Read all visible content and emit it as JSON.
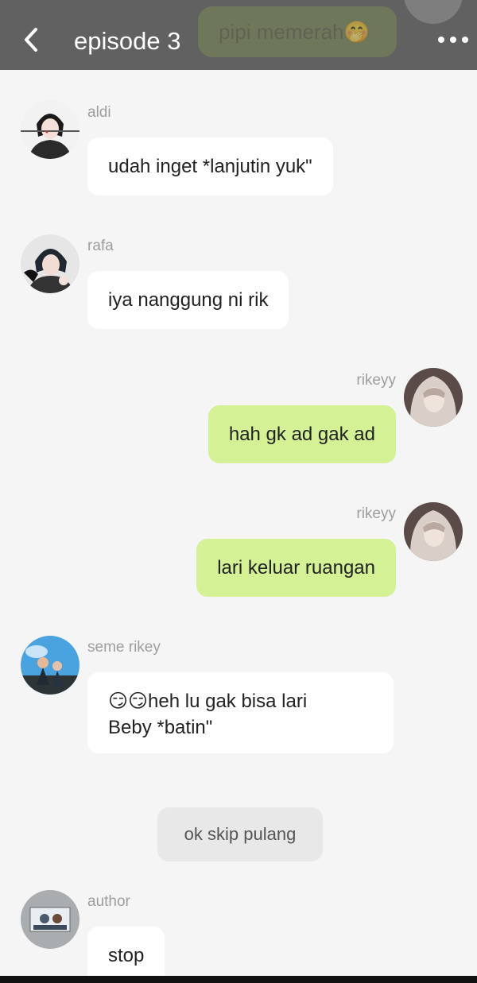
{
  "header": {
    "title": "episode 3",
    "faded_preview_text": "pipi memerah🤭",
    "back_icon": "chevron-left-icon",
    "more_icon": "more-dots-icon"
  },
  "messages": [
    {
      "sender": "aldi",
      "text": "udah inget *lanjutin yuk\"",
      "side": "left"
    },
    {
      "sender": "rafa",
      "text": "iya nanggung ni rik",
      "side": "left"
    },
    {
      "sender": "rikeyy",
      "text": "hah gk ad gak ad",
      "side": "right"
    },
    {
      "sender": "rikeyy",
      "text": "lari keluar ruangan",
      "side": "right"
    },
    {
      "sender": "seme rikey",
      "text_line1": "😏😏heh lu gak bisa lari",
      "text_line2": "Beby *batin\"",
      "side": "left"
    },
    {
      "system_text": "ok skip pulang"
    },
    {
      "sender": "author",
      "text": "stop",
      "side": "left"
    }
  ],
  "colors": {
    "header_bg": "#616161",
    "page_bg": "#f5f5f5",
    "bubble_left": "#ffffff",
    "bubble_right": "#d4f195",
    "name_text": "#9e9e9e"
  }
}
